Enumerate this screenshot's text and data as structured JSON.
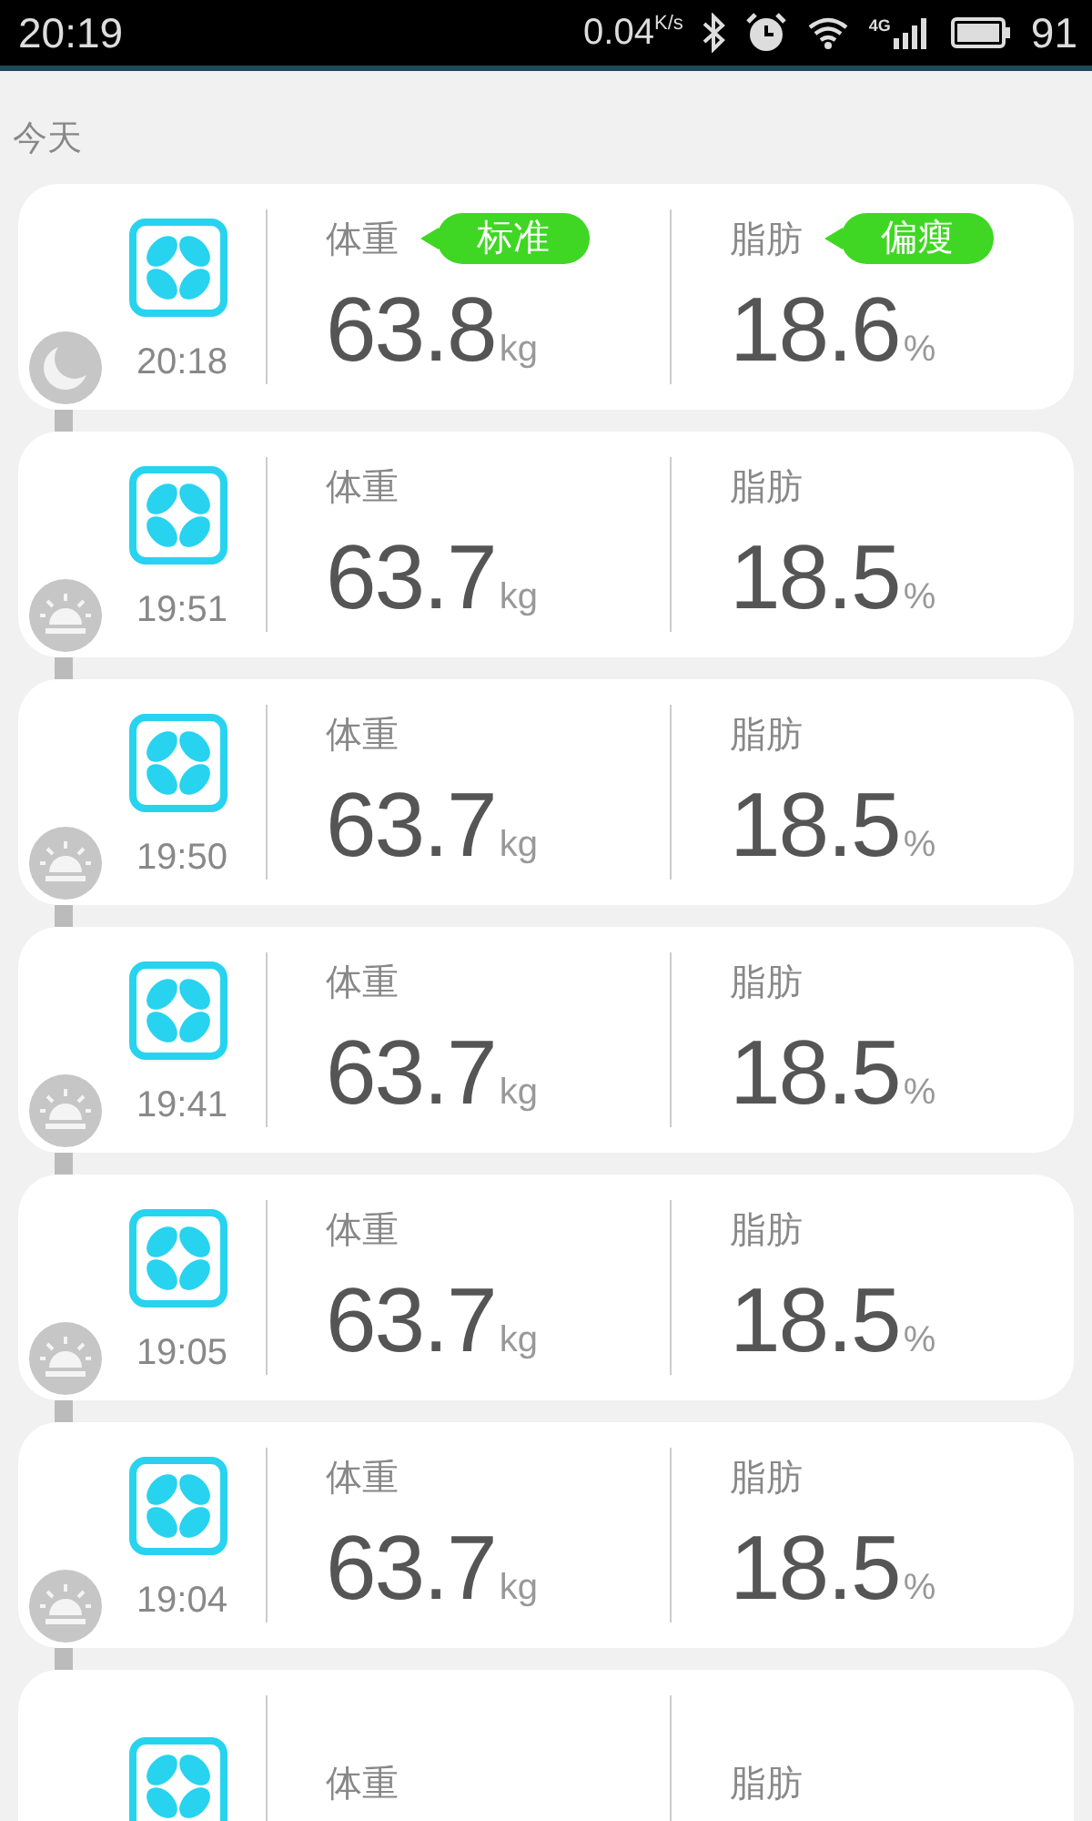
{
  "status_bar": {
    "time": "20:19",
    "speed": "0.04",
    "speed_unit": "K/s",
    "network": "4G",
    "battery": "91"
  },
  "section_title": "今天",
  "records": [
    {
      "kind": "night",
      "time": "20:18",
      "weight_label": "体重",
      "weight": "63.8",
      "weight_unit": "kg",
      "weight_tag": "标准",
      "fat_label": "脂肪",
      "fat": "18.6",
      "fat_unit": "%",
      "fat_tag": "偏瘦"
    },
    {
      "kind": "day",
      "time": "19:51",
      "weight_label": "体重",
      "weight": "63.7",
      "weight_unit": "kg",
      "fat_label": "脂肪",
      "fat": "18.5",
      "fat_unit": "%"
    },
    {
      "kind": "day",
      "time": "19:50",
      "weight_label": "体重",
      "weight": "63.7",
      "weight_unit": "kg",
      "fat_label": "脂肪",
      "fat": "18.5",
      "fat_unit": "%"
    },
    {
      "kind": "day",
      "time": "19:41",
      "weight_label": "体重",
      "weight": "63.7",
      "weight_unit": "kg",
      "fat_label": "脂肪",
      "fat": "18.5",
      "fat_unit": "%"
    },
    {
      "kind": "day",
      "time": "19:05",
      "weight_label": "体重",
      "weight": "63.7",
      "weight_unit": "kg",
      "fat_label": "脂肪",
      "fat": "18.5",
      "fat_unit": "%"
    },
    {
      "kind": "day",
      "time": "19:04",
      "weight_label": "体重",
      "weight": "63.7",
      "weight_unit": "kg",
      "fat_label": "脂肪",
      "fat": "18.5",
      "fat_unit": "%"
    },
    {
      "weight_label": "体重",
      "fat_label": "脂肪"
    }
  ]
}
